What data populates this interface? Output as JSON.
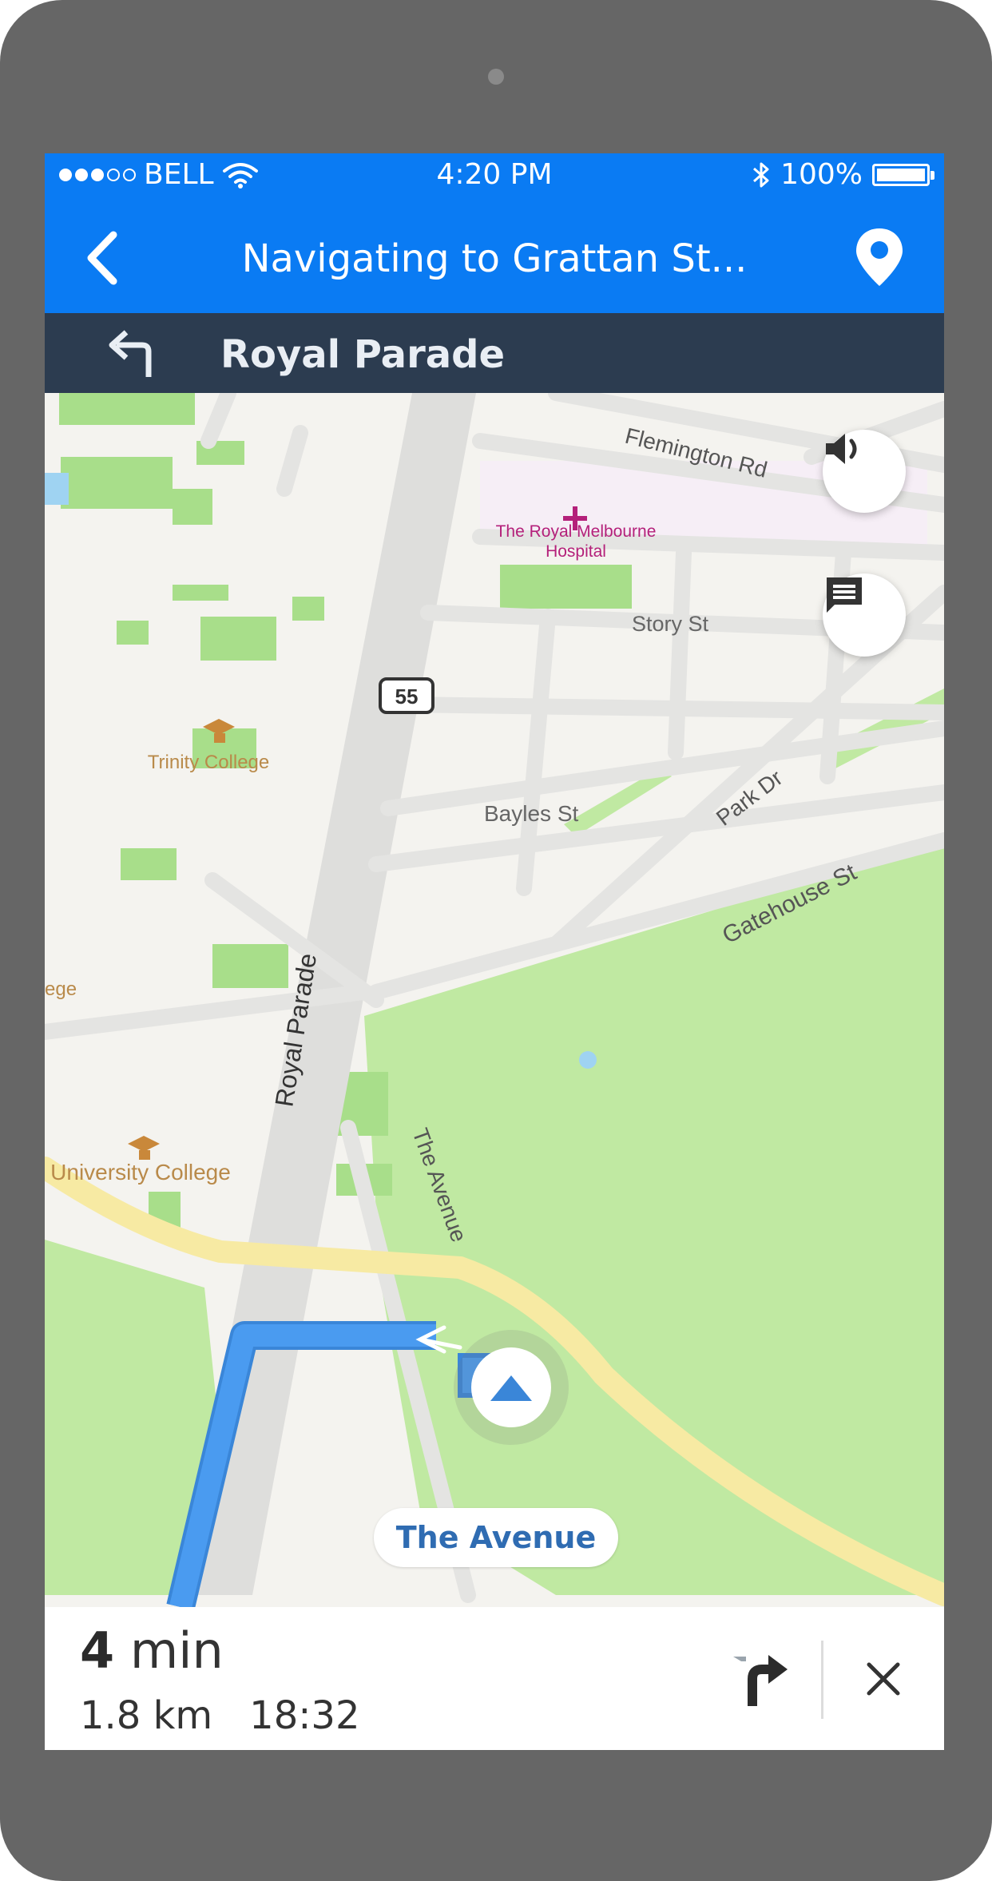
{
  "status_bar": {
    "carrier": "BELL",
    "signal_filled": 3,
    "signal_total": 5,
    "time": "4:20 PM",
    "battery_percent": "100%",
    "battery_level": 1.0,
    "icons": [
      "wifi-icon",
      "bluetooth-icon",
      "battery-icon"
    ]
  },
  "header": {
    "title": "Navigating to Grattan St...",
    "back_icon": "chevron-left-icon",
    "location_icon": "map-pin-icon",
    "color": "#0a7bf3"
  },
  "next_direction": {
    "street": "Royal Parade",
    "icon": "turn-left-icon",
    "color": "#2c3c50"
  },
  "map": {
    "labels": {
      "flemington": "Flemington Rd",
      "hospital_line1": "The Royal Melbourne",
      "hospital_line2": "Hospital",
      "story": "Story St",
      "route_shield": "55",
      "trinity": "Trinity College",
      "bayles": "Bayles St",
      "park": "Park Dr",
      "gatehouse": "Gatehouse St",
      "college_partial": "ege",
      "royal_parade": "Royal Parade",
      "the_avenue": "The Avenue",
      "university": "University College"
    },
    "current_street": "The Avenue",
    "route_color": "#4a9bf0",
    "park_color": "#c0e9a2",
    "buttons": {
      "sound": "volume-icon",
      "message": "message-icon"
    }
  },
  "trip": {
    "duration_value": "4",
    "duration_unit": "min",
    "distance": "1.8 km",
    "arrival": "18:32",
    "reroute_icon": "turn-right-icon",
    "close_icon": "close-icon"
  }
}
